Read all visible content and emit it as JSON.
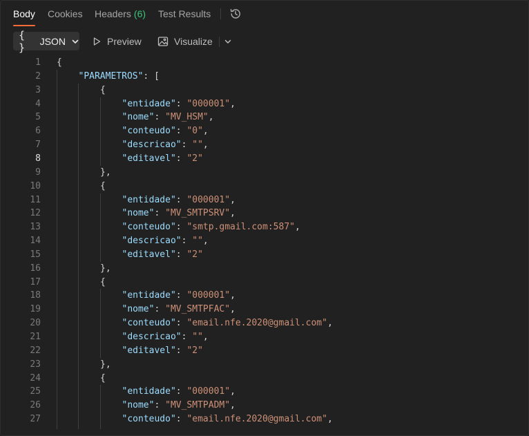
{
  "tabs": {
    "body": "Body",
    "cookies": "Cookies",
    "headers": "Headers",
    "headers_count": "(6)",
    "test_results": "Test Results"
  },
  "toolbar": {
    "format_braces": "{ }",
    "format_label": "JSON",
    "preview_label": "Preview",
    "visualize_label": "Visualize"
  },
  "colors": {
    "accent": "#ff6c37",
    "count": "#3cc279",
    "json_key": "#9cdcfe",
    "json_string": "#ce9178",
    "background": "#212121"
  },
  "icons": {
    "history": "history-icon",
    "chevron": "chevron-down-icon",
    "preview": "play-icon",
    "visualize": "image-icon"
  },
  "editor": {
    "current_line": 8,
    "lines": [
      {
        "n": "1",
        "indent": 0,
        "tokens": [
          {
            "t": "{",
            "c": "punct"
          }
        ]
      },
      {
        "n": "2",
        "indent": 1,
        "tokens": [
          {
            "t": "\"PARAMETROS\"",
            "c": "key"
          },
          {
            "t": ": [",
            "c": "punct"
          }
        ]
      },
      {
        "n": "3",
        "indent": 2,
        "tokens": [
          {
            "t": "{",
            "c": "punct"
          }
        ]
      },
      {
        "n": "4",
        "indent": 3,
        "tokens": [
          {
            "t": "\"entidade\"",
            "c": "key"
          },
          {
            "t": ": ",
            "c": "punct"
          },
          {
            "t": "\"000001\"",
            "c": "str"
          },
          {
            "t": ",",
            "c": "punct"
          }
        ]
      },
      {
        "n": "5",
        "indent": 3,
        "tokens": [
          {
            "t": "\"nome\"",
            "c": "key"
          },
          {
            "t": ": ",
            "c": "punct"
          },
          {
            "t": "\"MV_HSM\"",
            "c": "str"
          },
          {
            "t": ",",
            "c": "punct"
          }
        ]
      },
      {
        "n": "6",
        "indent": 3,
        "tokens": [
          {
            "t": "\"conteudo\"",
            "c": "key"
          },
          {
            "t": ": ",
            "c": "punct"
          },
          {
            "t": "\"0\"",
            "c": "str"
          },
          {
            "t": ",",
            "c": "punct"
          }
        ]
      },
      {
        "n": "7",
        "indent": 3,
        "tokens": [
          {
            "t": "\"descricao\"",
            "c": "key"
          },
          {
            "t": ": ",
            "c": "punct"
          },
          {
            "t": "\"\"",
            "c": "str"
          },
          {
            "t": ",",
            "c": "punct"
          }
        ]
      },
      {
        "n": "8",
        "indent": 3,
        "tokens": [
          {
            "t": "\"editavel\"",
            "c": "key"
          },
          {
            "t": ": ",
            "c": "punct"
          },
          {
            "t": "\"2\"",
            "c": "str"
          }
        ]
      },
      {
        "n": "9",
        "indent": 2,
        "tokens": [
          {
            "t": "},",
            "c": "punct"
          }
        ]
      },
      {
        "n": "10",
        "indent": 2,
        "tokens": [
          {
            "t": "{",
            "c": "punct"
          }
        ]
      },
      {
        "n": "11",
        "indent": 3,
        "tokens": [
          {
            "t": "\"entidade\"",
            "c": "key"
          },
          {
            "t": ": ",
            "c": "punct"
          },
          {
            "t": "\"000001\"",
            "c": "str"
          },
          {
            "t": ",",
            "c": "punct"
          }
        ]
      },
      {
        "n": "12",
        "indent": 3,
        "tokens": [
          {
            "t": "\"nome\"",
            "c": "key"
          },
          {
            "t": ": ",
            "c": "punct"
          },
          {
            "t": "\"MV_SMTPSRV\"",
            "c": "str"
          },
          {
            "t": ",",
            "c": "punct"
          }
        ]
      },
      {
        "n": "13",
        "indent": 3,
        "tokens": [
          {
            "t": "\"conteudo\"",
            "c": "key"
          },
          {
            "t": ": ",
            "c": "punct"
          },
          {
            "t": "\"smtp.gmail.com:587\"",
            "c": "str"
          },
          {
            "t": ",",
            "c": "punct"
          }
        ]
      },
      {
        "n": "14",
        "indent": 3,
        "tokens": [
          {
            "t": "\"descricao\"",
            "c": "key"
          },
          {
            "t": ": ",
            "c": "punct"
          },
          {
            "t": "\"\"",
            "c": "str"
          },
          {
            "t": ",",
            "c": "punct"
          }
        ]
      },
      {
        "n": "15",
        "indent": 3,
        "tokens": [
          {
            "t": "\"editavel\"",
            "c": "key"
          },
          {
            "t": ": ",
            "c": "punct"
          },
          {
            "t": "\"2\"",
            "c": "str"
          }
        ]
      },
      {
        "n": "16",
        "indent": 2,
        "tokens": [
          {
            "t": "},",
            "c": "punct"
          }
        ]
      },
      {
        "n": "17",
        "indent": 2,
        "tokens": [
          {
            "t": "{",
            "c": "punct"
          }
        ]
      },
      {
        "n": "18",
        "indent": 3,
        "tokens": [
          {
            "t": "\"entidade\"",
            "c": "key"
          },
          {
            "t": ": ",
            "c": "punct"
          },
          {
            "t": "\"000001\"",
            "c": "str"
          },
          {
            "t": ",",
            "c": "punct"
          }
        ]
      },
      {
        "n": "19",
        "indent": 3,
        "tokens": [
          {
            "t": "\"nome\"",
            "c": "key"
          },
          {
            "t": ": ",
            "c": "punct"
          },
          {
            "t": "\"MV_SMTPFAC\"",
            "c": "str"
          },
          {
            "t": ",",
            "c": "punct"
          }
        ]
      },
      {
        "n": "20",
        "indent": 3,
        "tokens": [
          {
            "t": "\"conteudo\"",
            "c": "key"
          },
          {
            "t": ": ",
            "c": "punct"
          },
          {
            "t": "\"email.nfe.2020@gmail.com\"",
            "c": "str"
          },
          {
            "t": ",",
            "c": "punct"
          }
        ]
      },
      {
        "n": "21",
        "indent": 3,
        "tokens": [
          {
            "t": "\"descricao\"",
            "c": "key"
          },
          {
            "t": ": ",
            "c": "punct"
          },
          {
            "t": "\"\"",
            "c": "str"
          },
          {
            "t": ",",
            "c": "punct"
          }
        ]
      },
      {
        "n": "22",
        "indent": 3,
        "tokens": [
          {
            "t": "\"editavel\"",
            "c": "key"
          },
          {
            "t": ": ",
            "c": "punct"
          },
          {
            "t": "\"2\"",
            "c": "str"
          }
        ]
      },
      {
        "n": "23",
        "indent": 2,
        "tokens": [
          {
            "t": "},",
            "c": "punct"
          }
        ]
      },
      {
        "n": "24",
        "indent": 2,
        "tokens": [
          {
            "t": "{",
            "c": "punct"
          }
        ]
      },
      {
        "n": "25",
        "indent": 3,
        "tokens": [
          {
            "t": "\"entidade\"",
            "c": "key"
          },
          {
            "t": ": ",
            "c": "punct"
          },
          {
            "t": "\"000001\"",
            "c": "str"
          },
          {
            "t": ",",
            "c": "punct"
          }
        ]
      },
      {
        "n": "26",
        "indent": 3,
        "tokens": [
          {
            "t": "\"nome\"",
            "c": "key"
          },
          {
            "t": ": ",
            "c": "punct"
          },
          {
            "t": "\"MV_SMTPADM\"",
            "c": "str"
          },
          {
            "t": ",",
            "c": "punct"
          }
        ]
      },
      {
        "n": "27",
        "indent": 3,
        "tokens": [
          {
            "t": "\"conteudo\"",
            "c": "key"
          },
          {
            "t": ": ",
            "c": "punct"
          },
          {
            "t": "\"email.nfe.2020@gmail.com\"",
            "c": "str"
          },
          {
            "t": ",",
            "c": "punct"
          }
        ]
      }
    ]
  }
}
